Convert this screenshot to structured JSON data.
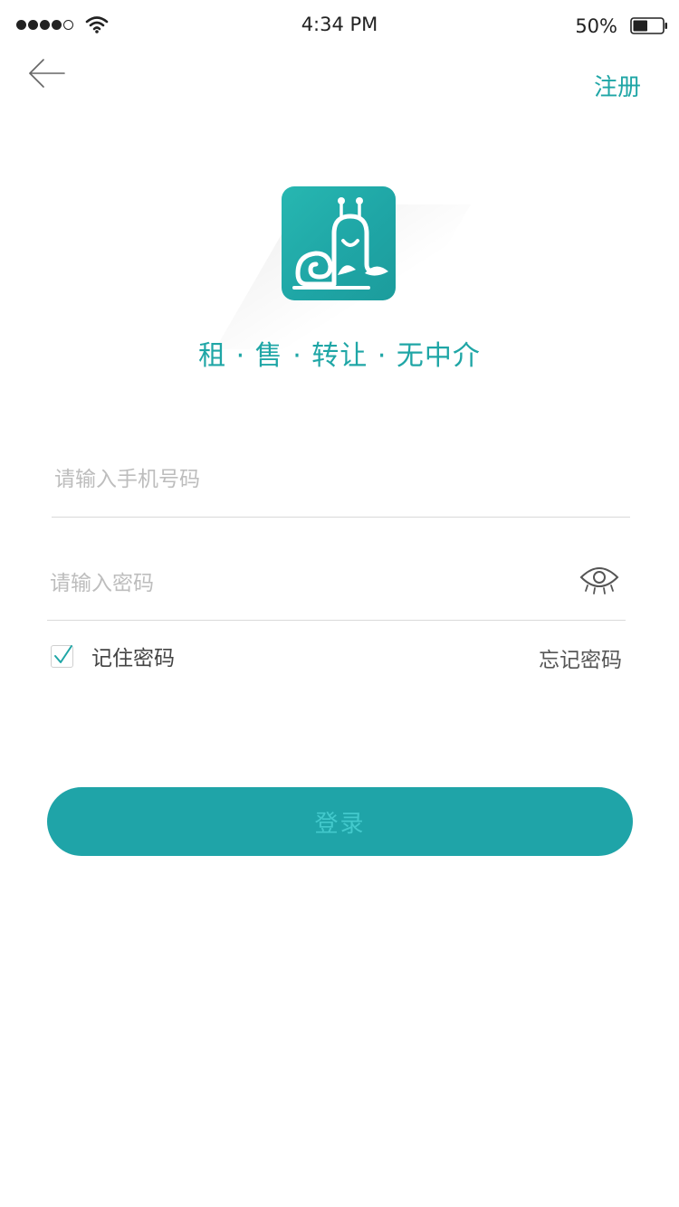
{
  "status_bar": {
    "time": "4:34 PM",
    "battery_percent": "50%",
    "battery_level": 0.5,
    "signal_bars_filled": 4,
    "signal_bars_total": 5
  },
  "nav": {
    "back_icon": "arrow-left-icon",
    "register_label": "注册"
  },
  "brand": {
    "logo_icon": "snail-logo-icon",
    "slogan": "租 · 售 · 转让 · 无中介"
  },
  "form": {
    "phone_placeholder": "请输入手机号码",
    "phone_value": "",
    "password_placeholder": "请输入密码",
    "password_value": "",
    "toggle_visibility_icon": "eye-icon",
    "remember_label": "记住密码",
    "remember_checked": true,
    "forgot_label": "忘记密码",
    "login_label": "登录"
  },
  "colors": {
    "accent": "#1fa6a6",
    "button_bg": "#1fa4a8",
    "button_text": "#43c9cc",
    "placeholder": "#bdbdbd",
    "divider": "#d9d9d9"
  }
}
